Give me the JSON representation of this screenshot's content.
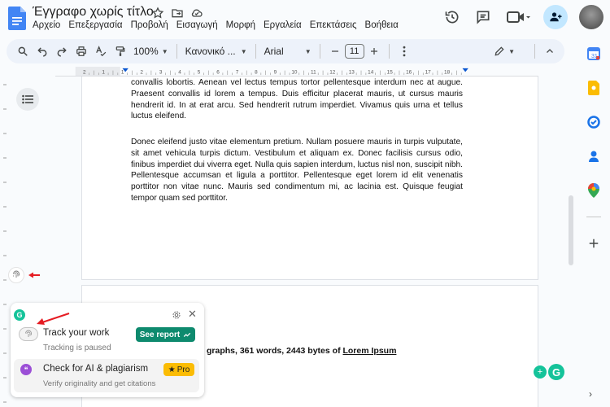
{
  "app": {
    "doc_title": "Έγγραφο χωρίς τίτλο",
    "menus": [
      "Αρχείο",
      "Επεξεργασία",
      "Προβολή",
      "Εισαγωγή",
      "Μορφή",
      "Εργαλεία",
      "Επεκτάσεις",
      "Βοήθεια"
    ]
  },
  "toolbar": {
    "zoom": "100%",
    "style": "Κανονικό ...",
    "font": "Arial",
    "font_size": "11"
  },
  "ruler": {
    "ticks": [
      "2",
      "1",
      "1",
      "2",
      "3",
      "4",
      "5",
      "6",
      "7",
      "8",
      "9",
      "10",
      "11",
      "12",
      "13",
      "14",
      "15",
      "16",
      "17",
      "18"
    ]
  },
  "document": {
    "para1": "convallis lobortis. Aenean vel lectus tempus tortor pellentesque interdum nec at augue. Praesent convallis id lorem a tempus. Duis efficitur placerat mauris, ut cursus mauris hendrerit id. In at erat arcu. Sed hendrerit rutrum imperdiet. Vivamus quis urna et tellus luctus eleifend.",
    "para2": "Donec eleifend justo vitae elementum pretium. Nullam posuere mauris in turpis vulputate, sit amet vehicula turpis dictum. Vestibulum et aliquam ex. Donec facilisis cursus odio, finibus imperdiet dui viverra eget. Nulla quis sapien interdum, luctus nisl non, suscipit nibh. Pellentesque accumsan et ligula a porttitor. Pellentesque eget lorem id elit venenatis porttitor non vitae nunc. Mauris sed condimentum mi, ac lacinia est. Quisque feugiat tempor quam sed porttitor.",
    "summary_text": "graphs, 361 words, 2443 bytes of ",
    "summary_link": "Lorem Ipsum"
  },
  "grammarly_popup": {
    "track_title": "Track your work",
    "track_status": "Tracking is paused",
    "see_report": "See report",
    "check_title": "Check for AI & plagiarism",
    "check_sub": "Verify originality and get citations",
    "pro_label": "Pro"
  },
  "colors": {
    "accent": "#0b57d0",
    "grammarly_green": "#15c39a",
    "see_report_bg": "#0e8a6e",
    "pro_badge": "#fbbc04",
    "arrow_red": "#e51c23"
  }
}
